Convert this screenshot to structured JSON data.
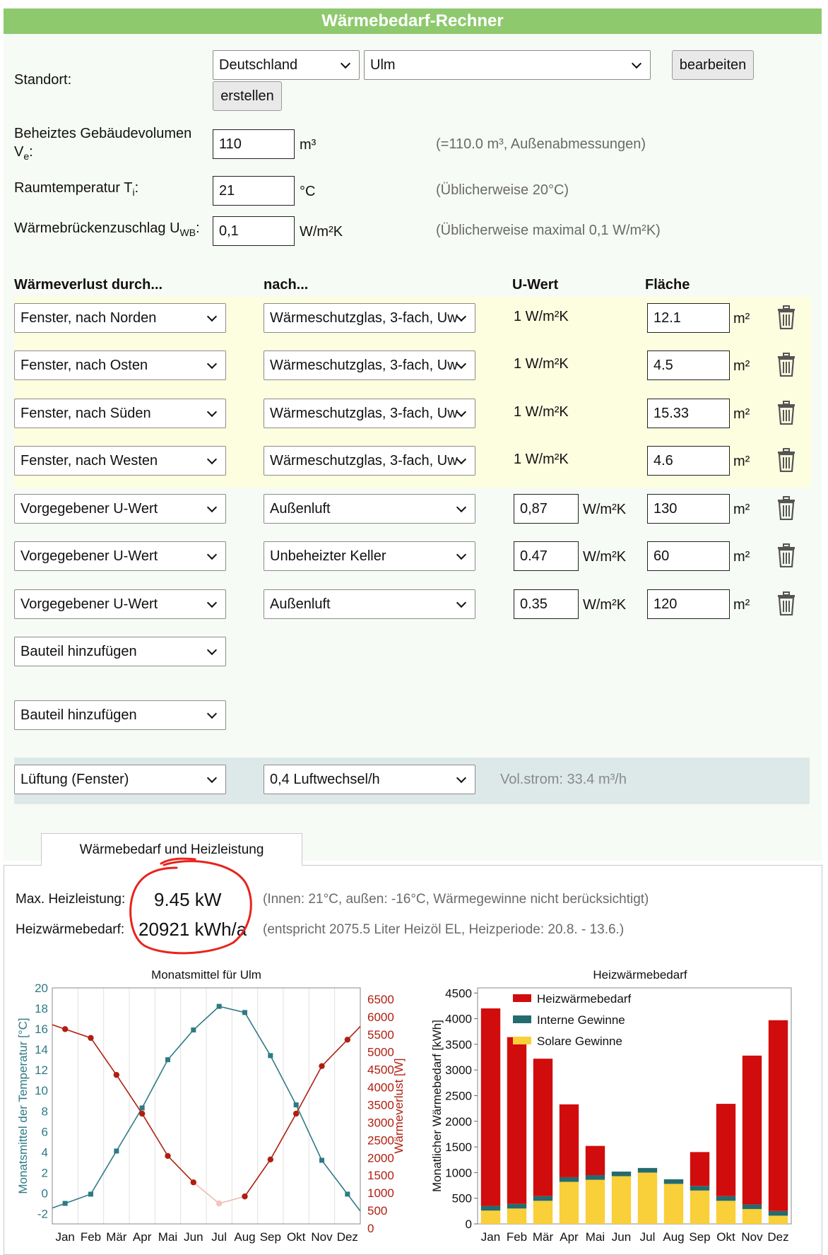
{
  "app": {
    "title": "Wärmebedarf-Rechner"
  },
  "standort": {
    "label": "Standort:",
    "country": "Deutschland",
    "city": "Ulm",
    "edit_button": "bearbeiten",
    "create_button": "erstellen"
  },
  "volume": {
    "label_main": "Beheiztes Gebäudevolumen V",
    "label_sub": "e",
    "label_tail": ":",
    "value": "110",
    "unit": "m³",
    "hint": "(=110.0 m³, Außenabmessungen)"
  },
  "room_temp": {
    "label_main": "Raumtemperatur T",
    "label_sub": "i",
    "label_tail": ":",
    "value": "21",
    "unit": "°C",
    "hint": "(Üblicherweise 20°C)"
  },
  "thermal_bridge": {
    "label_main": "Wärmebrückenzuschlag U",
    "label_sub": "WB",
    "label_tail": ":",
    "value": "0,1",
    "unit": "W/m²K",
    "hint": "(Üblicherweise maximal 0,1 W/m²K)"
  },
  "table": {
    "headers": {
      "loss": "Wärmeverlust durch...",
      "to": "nach...",
      "u": "U-Wert",
      "area": "Fläche"
    },
    "rows": [
      {
        "component": "Fenster, nach Norden",
        "target": "Wärmeschutzglas, 3-fach, Uw",
        "u_text": "1 W/m²K",
        "u_input": "",
        "area": "12.1",
        "area_unit": "m²"
      },
      {
        "component": "Fenster, nach Osten",
        "target": "Wärmeschutzglas, 3-fach, Uw",
        "u_text": "1 W/m²K",
        "u_input": "",
        "area": "4.5",
        "area_unit": "m²"
      },
      {
        "component": "Fenster, nach Süden",
        "target": "Wärmeschutzglas, 3-fach, Uw",
        "u_text": "1 W/m²K",
        "u_input": "",
        "area": "15.33",
        "area_unit": "m²"
      },
      {
        "component": "Fenster, nach Westen",
        "target": "Wärmeschutzglas, 3-fach, Uw",
        "u_text": "1 W/m²K",
        "u_input": "",
        "area": "4.6",
        "area_unit": "m²"
      },
      {
        "component": "Vorgegebener U-Wert",
        "target": "Außenluft",
        "u_text": "",
        "u_input": "0,87",
        "u_unit": "W/m²K",
        "area": "130",
        "area_unit": "m²"
      },
      {
        "component": "Vorgegebener U-Wert",
        "target": "Unbeheizter Keller",
        "u_text": "",
        "u_input": "0.47",
        "u_unit": "W/m²K",
        "area": "60",
        "area_unit": "m²"
      },
      {
        "component": "Vorgegebener U-Wert",
        "target": "Außenluft",
        "u_text": "",
        "u_input": "0.35",
        "u_unit": "W/m²K",
        "area": "120",
        "area_unit": "m²"
      }
    ],
    "add_component_1": "Bauteil hinzufügen",
    "add_component_2": "Bauteil hinzufügen"
  },
  "ventilation": {
    "type": "Lüftung (Fenster)",
    "rate": "0,4 Luftwechsel/h",
    "flow": "Vol.strom: 33.4 m³/h"
  },
  "results": {
    "tab": "Wärmebedarf und Heizleistung",
    "max_power_label": "Max. Heizleistung:",
    "max_power_value": "9.45 kW",
    "max_power_hint": "(Innen: 21°C, außen: -16°C, Wärmegewinne nicht berücksichtigt)",
    "demand_label": "Heizwärmebedarf:",
    "demand_value": "20921 kWh/a",
    "demand_hint": "(entspricht 2075.5 Liter Heizöl EL, Heizperiode: 20.8. - 13.6.)"
  },
  "colors": {
    "title_green": "#8ec96e",
    "temp_teal": "#2e7a85",
    "loss_red": "#b01e10",
    "demand_red": "#d10c0c",
    "internal_teal": "#246b6f",
    "solar_yellow": "#f9cf3a",
    "annotation_red": "#e8231d"
  },
  "chart_data": [
    {
      "type": "line",
      "title": "Monatsmittel für Ulm",
      "categories": [
        "Jan",
        "Feb",
        "Mär",
        "Apr",
        "Mai",
        "Jun",
        "Jul",
        "Aug",
        "Sep",
        "Okt",
        "Nov",
        "Dez"
      ],
      "ylabel": "Monatsmittel der Temperatur [°C]",
      "y2label": "Wärmeverlust [W]",
      "ylim": [
        -3,
        20
      ],
      "y2lim": [
        0,
        6500
      ],
      "yticks": [
        -2,
        0,
        2,
        4,
        6,
        8,
        10,
        12,
        14,
        16,
        18,
        20
      ],
      "y2ticks": [
        0,
        500,
        1000,
        1500,
        2000,
        2500,
        3000,
        3500,
        4000,
        4500,
        5000,
        5500,
        6000,
        6500
      ],
      "series": [
        {
          "axis": "left",
          "values": [
            -1.0,
            -0.1,
            4.1,
            8.3,
            13.0,
            15.9,
            18.2,
            17.6,
            13.4,
            8.6,
            3.2,
            -0.1
          ]
        },
        {
          "axis": "right",
          "values": [
            5650,
            5400,
            4350,
            3250,
            2050,
            1300,
            700,
            900,
            1950,
            3250,
            4600,
            5350
          ]
        }
      ],
      "grid": true
    },
    {
      "type": "bar",
      "stacked": true,
      "title": "Heizwärmebedarf",
      "ylabel": "Monatlicher Wärmebedarf [kWh]",
      "categories": [
        "Jan",
        "Feb",
        "Mär",
        "Apr",
        "Mai",
        "Jun",
        "Jul",
        "Aug",
        "Sep",
        "Okt",
        "Nov",
        "Dez"
      ],
      "ylim": [
        0,
        4600
      ],
      "yticks": [
        0,
        500,
        1000,
        1500,
        2000,
        2500,
        3000,
        3500,
        4000,
        4500
      ],
      "legend": "top-right",
      "series": [
        {
          "name": "Solare Gewinne",
          "values": [
            260,
            300,
            450,
            820,
            860,
            930,
            1000,
            780,
            650,
            450,
            290,
            160
          ]
        },
        {
          "name": "Interne Gewinne",
          "values": [
            90,
            90,
            90,
            90,
            90,
            90,
            90,
            90,
            90,
            90,
            90,
            90
          ]
        },
        {
          "name": "Heizwärmebedarf",
          "values": [
            3850,
            3250,
            2680,
            1420,
            570,
            0,
            0,
            0,
            660,
            1800,
            2900,
            3720
          ]
        }
      ],
      "grid": false
    }
  ]
}
